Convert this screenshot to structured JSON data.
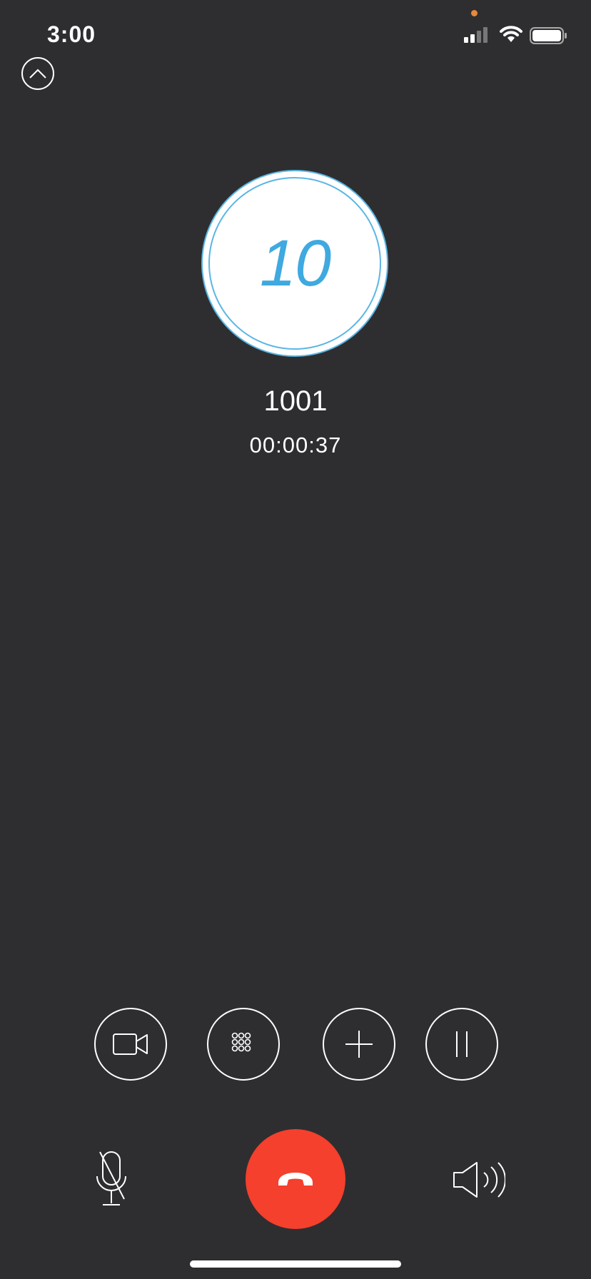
{
  "status_bar": {
    "time": "3:00",
    "icons": [
      "signal-icon",
      "wifi-icon",
      "battery-icon"
    ],
    "privacy_dot_color": "#e8893a"
  },
  "call": {
    "avatar_text": "10",
    "caller": "1001",
    "duration": "00:00:37"
  },
  "controls": {
    "row": [
      {
        "name": "video-button",
        "icon": "video-camera-icon"
      },
      {
        "name": "keypad-button",
        "icon": "keypad-icon"
      },
      {
        "name": "add-call-button",
        "icon": "plus-icon"
      },
      {
        "name": "hold-button",
        "icon": "pause-icon"
      }
    ],
    "bottom": [
      {
        "name": "mute-button",
        "icon": "microphone-muted-icon"
      },
      {
        "name": "end-call-button",
        "icon": "phone-hangup-icon"
      },
      {
        "name": "speaker-button",
        "icon": "speaker-icon"
      }
    ]
  },
  "colors": {
    "background": "#2e2e30",
    "accent": "#3fa9e0",
    "hangup": "#f4402c"
  }
}
